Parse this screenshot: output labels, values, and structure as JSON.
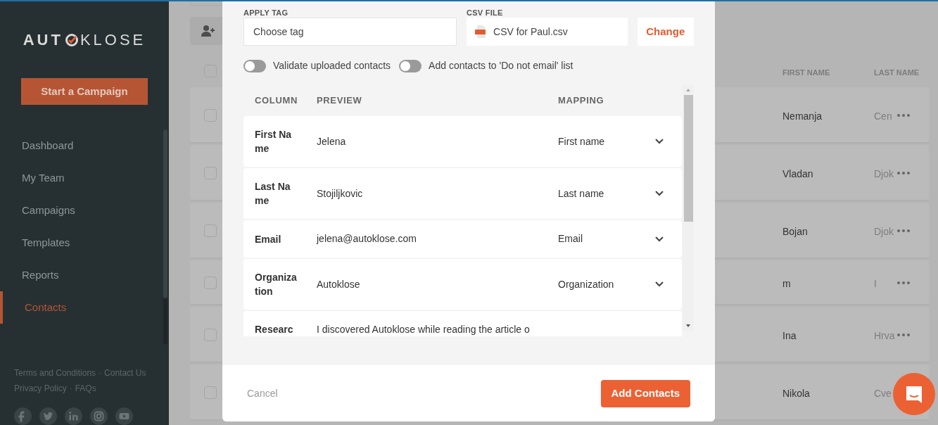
{
  "sidebar": {
    "logo": {
      "left": "AUT",
      "right": "KLOSE"
    },
    "cta": "Start a Campaign",
    "items": [
      {
        "label": "Dashboard",
        "selected": false
      },
      {
        "label": "My Team",
        "selected": false
      },
      {
        "label": "Campaigns",
        "selected": false
      },
      {
        "label": "Templates",
        "selected": false
      },
      {
        "label": "Reports",
        "selected": false
      },
      {
        "label": "Contacts",
        "selected": true
      }
    ],
    "footer_links": [
      [
        "Terms and Conditions",
        "·",
        "Contact Us"
      ],
      [
        "Privacy Policy",
        "·",
        "FAQs"
      ]
    ]
  },
  "contacts_table": {
    "select_all_checked": false,
    "columns": [
      "FIRST NAME",
      "LAST NAME"
    ],
    "rows": [
      {
        "checked": false,
        "first_name": "Nemanja",
        "last_name": "Cen"
      },
      {
        "checked": false,
        "first_name": "Vladan",
        "last_name": "Djok"
      },
      {
        "checked": false,
        "first_name": "Bojan",
        "last_name": "Djok"
      },
      {
        "checked": false,
        "first_name": "m",
        "last_name": "I"
      },
      {
        "checked": false,
        "first_name": "Ina",
        "last_name": "Hrva"
      },
      {
        "checked": false,
        "first_name": "Nikola",
        "last_name": "Cve"
      }
    ]
  },
  "modal": {
    "apply_tag": {
      "label": "APPLY TAG",
      "placeholder": "Choose tag"
    },
    "csv_file": {
      "label": "CSV FILE",
      "filename": "CSV for Paul.csv",
      "button": "Change"
    },
    "toggles": [
      {
        "label": "Validate uploaded contacts",
        "on": false
      },
      {
        "label": "Add contacts to 'Do not email' list",
        "on": false
      }
    ],
    "mapping": {
      "columns": [
        "COLUMN",
        "PREVIEW",
        "MAPPING"
      ],
      "rows": [
        {
          "column": "First Name",
          "preview": "Jelena",
          "mapping": "First name"
        },
        {
          "column": "Last Name",
          "preview": "Stojiljkovic",
          "mapping": "Last name"
        },
        {
          "column": "Email",
          "preview": "jelena@autoklose.com",
          "mapping": "Email"
        },
        {
          "column": "Organization",
          "preview": "Autoklose",
          "mapping": "Organization"
        },
        {
          "column": "Researc",
          "preview": "I discovered Autoklose while reading the article o"
        }
      ]
    },
    "cancel": "Cancel",
    "submit": "Add Contacts"
  }
}
